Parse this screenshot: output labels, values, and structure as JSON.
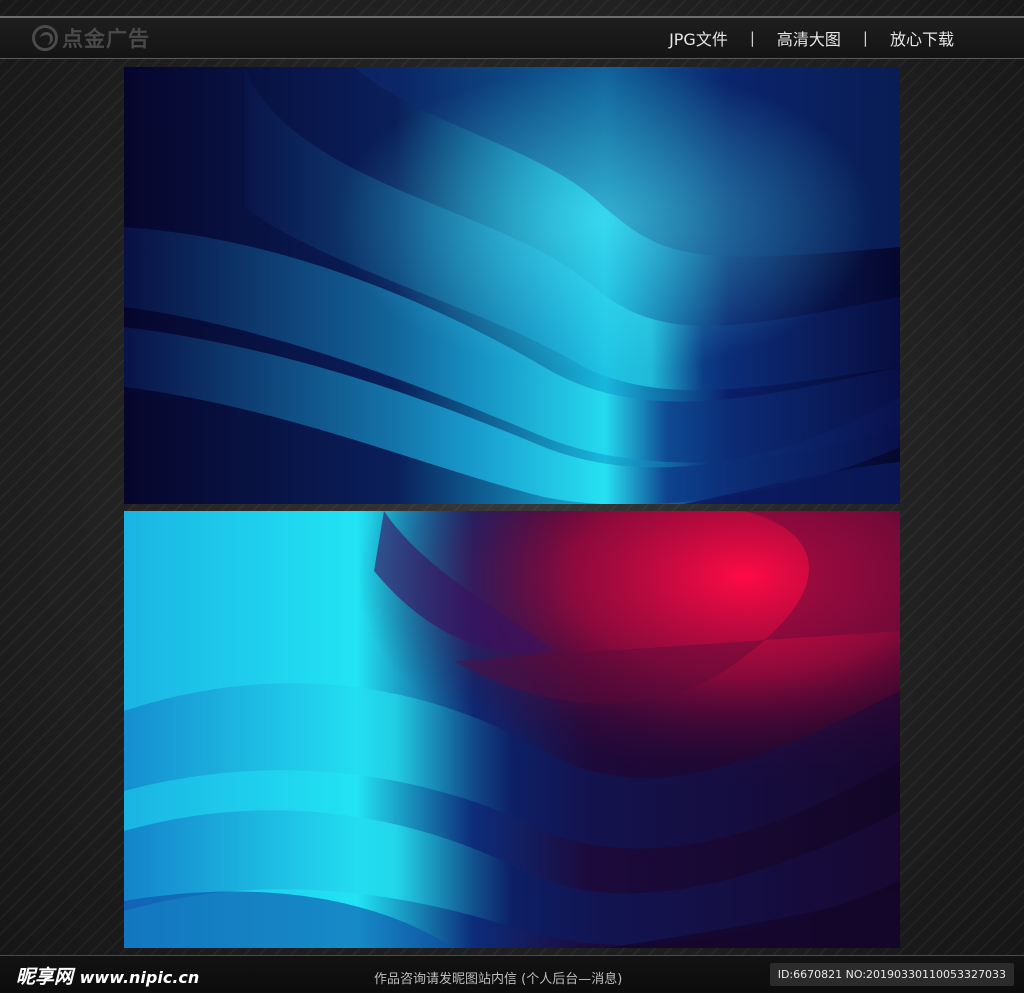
{
  "header": {
    "logo_text": "点金广告",
    "nav": [
      {
        "label": "JPG文件"
      },
      {
        "label": "高清大图"
      },
      {
        "label": "放心下载"
      }
    ]
  },
  "footer": {
    "brand": "昵享网",
    "site": "www.nipic.cn",
    "note": "作品咨询请发昵图站内信 (个人后台—消息)",
    "id_text": "ID:6670821 NO:20190330110053327033"
  },
  "colors": {
    "cyan": "#20e6f5",
    "navy": "#07072e",
    "red": "#f0063f"
  }
}
